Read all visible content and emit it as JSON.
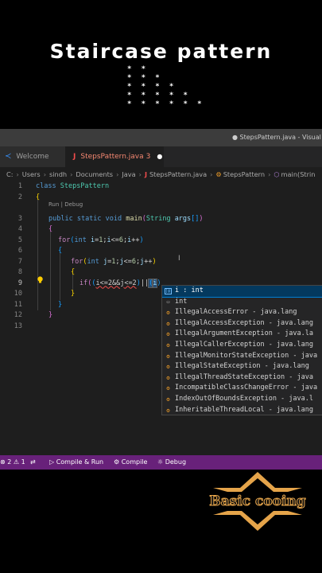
{
  "overlay": {
    "title": "Staircase pattern",
    "star_rows": [
      "* *",
      "* * *",
      "* * * *",
      "* * * * *",
      "* * * * * *"
    ],
    "logo_text": "Basic cooing"
  },
  "window": {
    "title": "● StepsPattern.java - Visual Stu"
  },
  "tabs": [
    {
      "label": "Welcome"
    },
    {
      "label": "StepsPattern.java",
      "badge": "3",
      "dirty": "●"
    }
  ],
  "breadcrumb": [
    "C:",
    "Users",
    "sindh",
    "Documents",
    "Java",
    "StepsPattern.java",
    "StepsPattern",
    "main(Strin"
  ],
  "editor": {
    "line_numbers": [
      "1",
      "2",
      "3",
      "4",
      "5",
      "6",
      "7",
      "8",
      "9",
      "10",
      "11",
      "12",
      "13"
    ],
    "codelens": "Run | Debug",
    "lines": {
      "l1": [
        "class ",
        "StepsPattern"
      ],
      "l2": [
        "{"
      ],
      "l3": [
        "public ",
        "static ",
        "void ",
        "main",
        "(",
        "String ",
        "args",
        "[]",
        ")"
      ],
      "l4": [
        "{"
      ],
      "l5": [
        "for",
        "(",
        "int ",
        "i",
        "=",
        "1",
        ";",
        "i",
        "<=",
        "6",
        ";",
        "i",
        "++",
        ")"
      ],
      "l6": [
        "{"
      ],
      "l7": [
        "for",
        "(",
        "int ",
        "j",
        "=",
        "1",
        ";",
        "j",
        "<=",
        "6",
        ";",
        "j",
        "++",
        ")"
      ],
      "l8": [
        "{"
      ],
      "l9": [
        "if",
        "(",
        "(",
        "i<=2&&j<=2",
        ")",
        "||",
        "(",
        "i",
        ")"
      ],
      "l10": [
        "}"
      ],
      "l11": [
        "}"
      ],
      "l12": [
        "}"
      ]
    }
  },
  "suggestions": [
    {
      "label": "i : int",
      "icon": "variable-icon",
      "selected": true
    },
    {
      "label": "int",
      "icon": "keyword-icon"
    },
    {
      "label": "IllegalAccessError - java.lang",
      "icon": "class-icon"
    },
    {
      "label": "IllegalAccessException - java.lang",
      "icon": "class-icon"
    },
    {
      "label": "IllegalArgumentException - java.la",
      "icon": "class-icon"
    },
    {
      "label": "IllegalCallerException - java.lang",
      "icon": "class-icon"
    },
    {
      "label": "IllegalMonitorStateException - java",
      "icon": "class-icon"
    },
    {
      "label": "IllegalStateException - java.lang",
      "icon": "class-icon"
    },
    {
      "label": "IllegalThreadStateException - java",
      "icon": "class-icon"
    },
    {
      "label": "IncompatibleClassChangeError - java",
      "icon": "class-icon"
    },
    {
      "label": "IndexOutOfBoundsException - java.l",
      "icon": "class-icon"
    },
    {
      "label": "InheritableThreadLocal - java.lang",
      "icon": "class-icon"
    }
  ],
  "statusbar": {
    "errors": "2",
    "warnings": "1",
    "compile_run": "Compile & Run",
    "compile": "Compile",
    "debug": "Debug"
  },
  "colors": {
    "statusbar": "#68217a",
    "editor_bg": "#1e1e1e",
    "suggest_selected": "#04395e",
    "logo": "#e5a44a"
  }
}
